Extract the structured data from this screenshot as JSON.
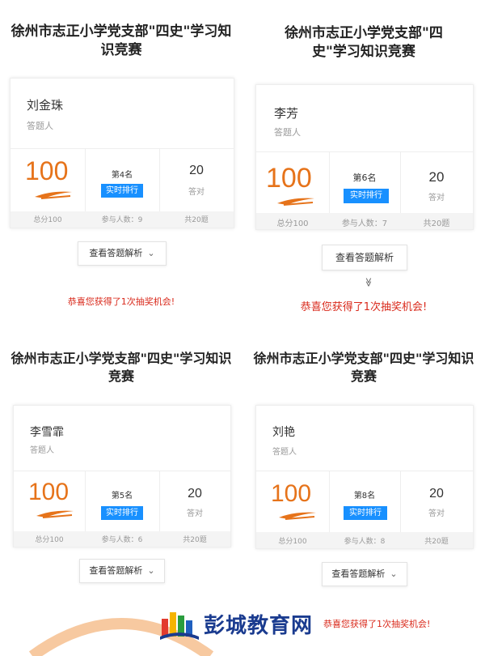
{
  "quiz_title": "徐州市志正小学党支部\"四史\"学习知识竞赛",
  "labels": {
    "answerer": "答题人",
    "realtime_rank": "实时排行",
    "correct": "答对",
    "view_analysis": "查看答题解析",
    "congrats": "恭喜您获得了1次抽奖机会!",
    "chevron": "≫"
  },
  "panels": [
    {
      "title_lines": [
        "徐州市志正小学党支部\"四史\"学习知",
        "识竞赛"
      ],
      "name": "刘金珠",
      "score": "100",
      "rank": "第4名",
      "correct_count": "20",
      "total_score": "总分100",
      "participants": "参与人数：9",
      "total_questions": "共20题"
    },
    {
      "title_lines": [
        "徐州市志正小学党支部\"四",
        "史\"学习知识竞赛"
      ],
      "name": "李芳",
      "score": "100",
      "rank": "第6名",
      "correct_count": "20",
      "total_score": "总分100",
      "participants": "参与人数：7",
      "total_questions": "共20题"
    },
    {
      "title_lines": [
        "徐州市志正小学党支部\"四史\"学习知识",
        "竞赛"
      ],
      "name": "李雪霏",
      "score": "100",
      "rank": "第5名",
      "correct_count": "20",
      "total_score": "总分100",
      "participants": "参与人数：6",
      "total_questions": "共20题"
    },
    {
      "title_lines": [
        "徐州市志正小学党支部\"四史\"学习知识",
        "竞赛"
      ],
      "name": "刘艳",
      "score": "100",
      "rank": "第8名",
      "correct_count": "20",
      "total_score": "总分100",
      "participants": "参与人数：8",
      "total_questions": "共20题"
    }
  ],
  "watermark": {
    "text": "彭城教育网",
    "colors": {
      "text": "#1a3b8f",
      "orange": "#f5a04a"
    }
  },
  "colors": {
    "accent_orange": "#e6731a",
    "button_blue": "#1890ff",
    "congrats_red": "#d9291b"
  }
}
